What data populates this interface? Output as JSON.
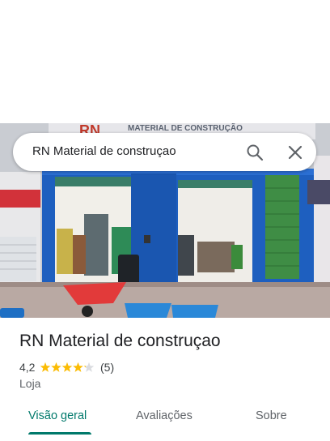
{
  "search": {
    "query": "RN Material de construçao"
  },
  "place": {
    "name": "RN Material de construçao",
    "rating": "4,2",
    "rating_stars": 4.2,
    "review_count": "(5)",
    "category": "Loja"
  },
  "photo": {
    "sign_letters": "RN",
    "sign_text": "MATERIAL DE CONSTRUÇÃO"
  },
  "tabs": [
    {
      "label": "Visão geral",
      "active": true
    },
    {
      "label": "Avaliações",
      "active": false
    },
    {
      "label": "Sobre",
      "active": false
    }
  ],
  "colors": {
    "accent": "#00796b",
    "star": "#fbbc04",
    "facade_blue": "#1e5fbf"
  }
}
